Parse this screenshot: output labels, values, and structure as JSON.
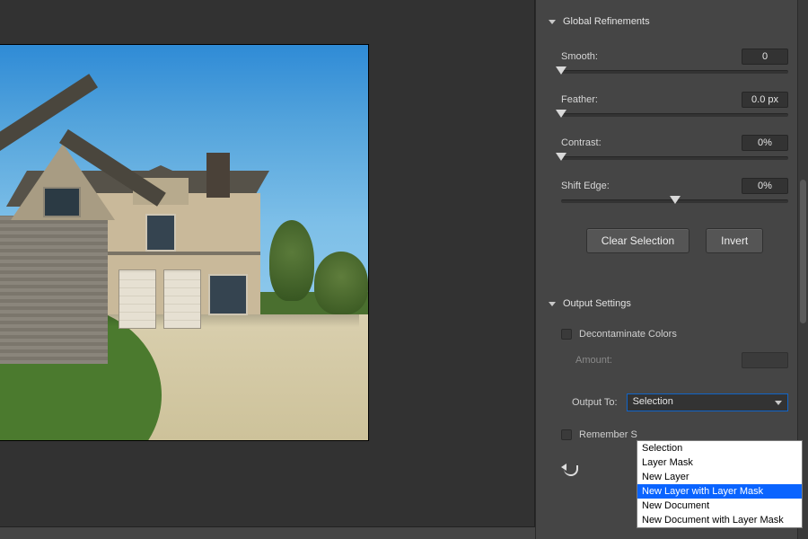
{
  "sections": {
    "global_refinements_title": "Global Refinements",
    "output_settings_title": "Output Settings"
  },
  "refinements": {
    "smooth": {
      "label": "Smooth:",
      "value": "0",
      "pos": 0
    },
    "feather": {
      "label": "Feather:",
      "value": "0.0 px",
      "pos": 0
    },
    "contrast": {
      "label": "Contrast:",
      "value": "0%",
      "pos": 0
    },
    "shift_edge": {
      "label": "Shift Edge:",
      "value": "0%",
      "pos": 50
    }
  },
  "buttons": {
    "clear_selection": "Clear Selection",
    "invert": "Invert"
  },
  "output": {
    "decontaminate_label": "Decontaminate Colors",
    "amount_label": "Amount:",
    "output_to_label": "Output To:",
    "output_to_selected": "Selection",
    "options": [
      "Selection",
      "Layer Mask",
      "New Layer",
      "New Layer with Layer Mask",
      "New Document",
      "New Document with Layer Mask"
    ],
    "highlighted_index": 3,
    "remember_label": "Remember S"
  }
}
